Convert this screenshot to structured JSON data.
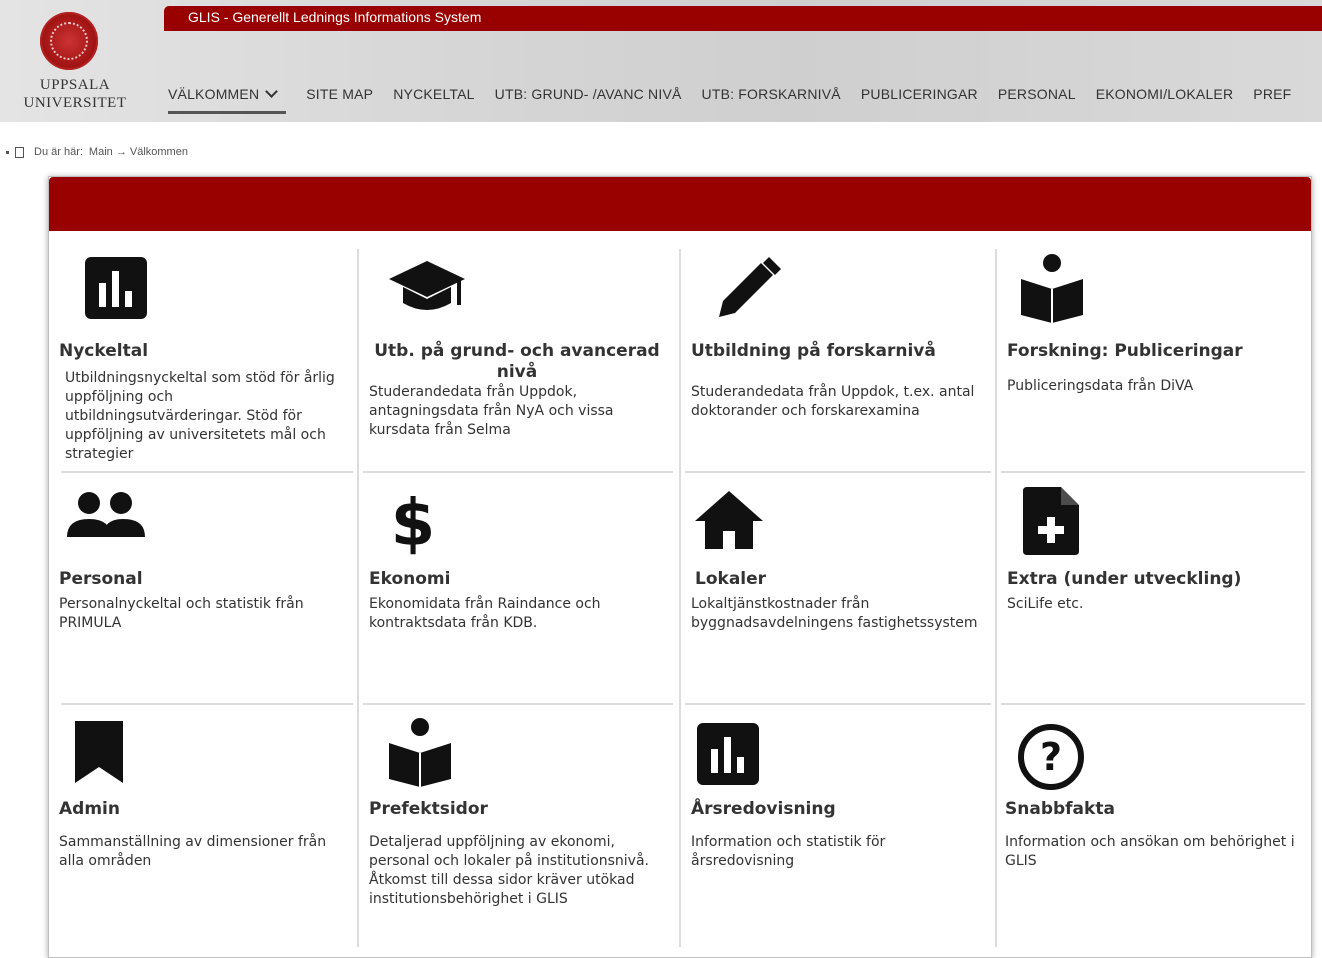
{
  "header": {
    "system_title": "GLIS - Generellt Lednings Informations System",
    "logo_line1": "UPPSALA",
    "logo_line2": "UNIVERSITET",
    "nav": [
      {
        "label": "VÄLKOMMEN"
      },
      {
        "label": "SITE MAP"
      },
      {
        "label": "NYCKELTAL"
      },
      {
        "label": "UTB: GRUND- /AVANC NIVÅ"
      },
      {
        "label": "UTB: FORSKARNIVÅ"
      },
      {
        "label": "PUBLICERINGAR"
      },
      {
        "label": "PERSONAL"
      },
      {
        "label": "EKONOMI/LOKALER"
      },
      {
        "label": "PREF"
      }
    ]
  },
  "breadcrumb": {
    "label": "Du är här:",
    "path": "Main → Välkommen"
  },
  "tiles": [
    {
      "title": "Nyckeltal",
      "desc": "Utbildningsnyckeltal som stöd för årlig uppföljning och utbildningsutvärderingar. Stöd för uppföljning av universitetets mål och strategier",
      "icon": "bar-chart-icon"
    },
    {
      "title": "Utb. på grund- och avancerad nivå",
      "desc": "Studerandedata från Uppdok, antagningsdata från NyA och vissa kursdata från Selma",
      "icon": "graduation-cap-icon"
    },
    {
      "title": "Utbildning på forskarnivå",
      "desc": "Studerandedata från Uppdok, t.ex. antal doktorander och forskarexamina",
      "icon": "pencil-icon"
    },
    {
      "title": "Forskning: Publiceringar",
      "desc": "Publiceringsdata från DiVA",
      "icon": "reader-icon"
    },
    {
      "title": "Personal",
      "desc": "Personalnyckeltal och statistik från PRIMULA",
      "icon": "people-icon"
    },
    {
      "title": "Ekonomi",
      "desc": "Ekonomidata från Raindance och kontraktsdata från KDB.",
      "icon": "dollar-icon"
    },
    {
      "title": "Lokaler",
      "desc": "Lokaltjänstkostnader från byggnadsavdelningens fastighetssystem",
      "icon": "home-icon"
    },
    {
      "title": "Extra (under utveckling)",
      "desc": "SciLife etc.",
      "icon": "file-plus-icon"
    },
    {
      "title": "Admin",
      "desc": "Sammanställning av dimensioner från alla områden",
      "icon": "bookmark-icon"
    },
    {
      "title": "Prefektsidor",
      "desc": "Detaljerad uppföljning av ekonomi, personal och lokaler på institutionsnivå. Åtkomst till dessa sidor kräver utökad institutionsbehörighet i GLIS",
      "icon": "reader-icon"
    },
    {
      "title": "Årsredovisning",
      "desc": "Information och statistik för årsredovisning",
      "icon": "bar-chart-icon"
    },
    {
      "title": "Snabbfakta",
      "desc": "Information och ansökan om behörighet i GLIS",
      "icon": "question-circle-icon"
    }
  ],
  "colors": {
    "brand_red": "#990000",
    "icon": "#111111"
  }
}
